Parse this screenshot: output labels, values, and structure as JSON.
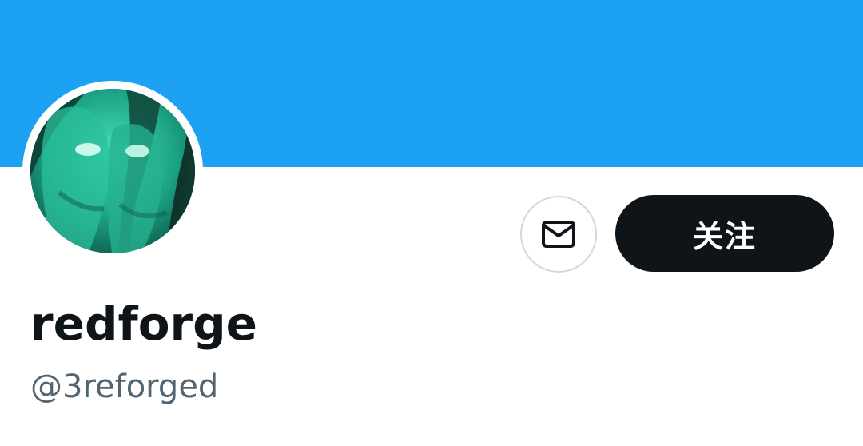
{
  "profile": {
    "display_name": "redforge",
    "handle": "@3reforged",
    "avatar_icon": "avatar-image"
  },
  "actions": {
    "message_icon": "envelope-icon",
    "follow_label": "关注"
  },
  "colors": {
    "banner": "#1da1f2",
    "follow_button_bg": "#0f1419",
    "follow_button_text": "#ffffff",
    "handle_text": "#536471",
    "name_text": "#0f1419",
    "outline": "#cfd9de"
  }
}
